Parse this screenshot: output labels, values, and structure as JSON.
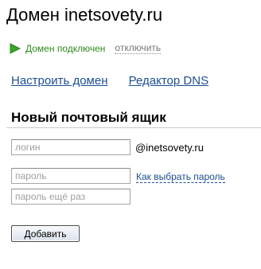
{
  "page": {
    "title": "Домен inetsovety.ru"
  },
  "status": {
    "icon": "play-triangle-icon",
    "color": "#2e8b1e",
    "text": "Домен подключен",
    "disconnect_label": "отключить"
  },
  "nav": {
    "configure_domain": "Настроить домен",
    "dns_editor": "Редактор DNS"
  },
  "mailbox_form": {
    "title": "Новый почтовый ящик",
    "login_placeholder": "логин",
    "login_value": "",
    "domain_suffix": "@inetsovety.ru",
    "password_placeholder": "пароль",
    "password_value": "",
    "password_help_link": "Как выбрать пароль",
    "password_repeat_placeholder": "пароль ещё раз",
    "password_repeat_value": "",
    "submit_label": "Добавить"
  }
}
